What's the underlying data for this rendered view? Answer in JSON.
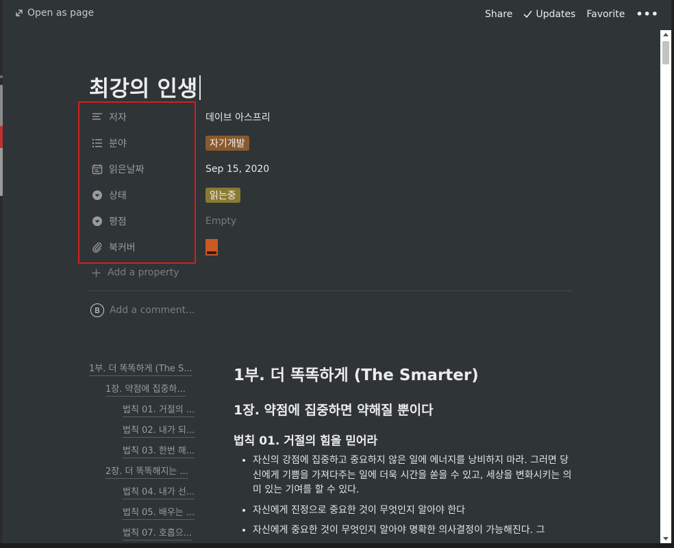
{
  "topbar": {
    "open_as_page": "Open as page",
    "share": "Share",
    "updates": "Updates",
    "favorite": "Favorite",
    "more": "•••"
  },
  "page": {
    "title": "최강의 인생"
  },
  "properties": [
    {
      "name": "저자",
      "icon": "text-lines-icon",
      "value": "데이브 아스프리"
    },
    {
      "name": "분야",
      "icon": "multi-select-list-icon",
      "value": "자기개발"
    },
    {
      "name": "읽은날짜",
      "icon": "calendar-icon",
      "value": "Sep 15, 2020"
    },
    {
      "name": "상태",
      "icon": "select-chevron-icon",
      "value": "읽는중"
    },
    {
      "name": "평점",
      "icon": "select-chevron-icon",
      "value": "Empty"
    },
    {
      "name": "북커버",
      "icon": "paperclip-icon",
      "value": ""
    }
  ],
  "colors": {
    "tag_orange": "#8a5a2e",
    "tag_olive": "#8a7b32",
    "highlight": "#d32020"
  },
  "add_property": "Add a property",
  "comment": {
    "avatar_letter": "B",
    "placeholder": "Add a comment..."
  },
  "toc": [
    {
      "label": "1부. 더 똑똑하게 (The S...",
      "level": 1
    },
    {
      "label": "1장. 약점에 집중하...",
      "level": 2
    },
    {
      "label": "법칙 01. 거절의 ...",
      "level": 3
    },
    {
      "label": "법칙 02. 내가 되...",
      "level": 3
    },
    {
      "label": "법칙 03. 한번 해...",
      "level": 3
    },
    {
      "label": "2장. 더 똑똑해지는 ...",
      "level": 2
    },
    {
      "label": "법칙 04. 내가 선...",
      "level": 3
    },
    {
      "label": "법칙 05. 배우는 ...",
      "level": 3
    },
    {
      "label": "법칙 07. 호흡으...",
      "level": 3
    }
  ],
  "content": {
    "h1": "1부. 더 똑똑하게 (The Smarter)",
    "h2": "1장. 약점에 집중하면 약해질 뿐이다",
    "h3": "법칙 01. 거절의 힘을 믿어라",
    "bullets": [
      "자신의 강점에 집중하고 중요하지 않은 일에 에너지를 낭비하지 마라. 그러면 당신에게 기쁨을 가져다주는 일에 더욱 시간을 쏟을 수 있고, 세상을 변화시키는 의미 있는 기여를 할 수 있다.",
      "자신에게 진정으로 중요한 것이 무엇인지 알아야 한다",
      "자신에게 중요한 것이 무엇인지 알아야 명확한 의사결정이 가능해진다. 그"
    ]
  }
}
